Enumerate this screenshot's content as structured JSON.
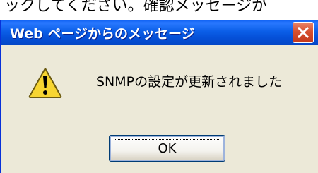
{
  "background": {
    "partial_text": "ックしてください。確認メッセージが"
  },
  "dialog": {
    "title": "Web ページからのメッセージ",
    "message": "SNMPの設定が更新されました",
    "ok_label": "OK",
    "icon": "warning-icon",
    "close_icon": "close-icon"
  },
  "colors": {
    "titlebar": "#0b5fe8",
    "close_button": "#d6502f",
    "dialog_body": "#ece9d8",
    "warning_fill": "#f7d531"
  }
}
